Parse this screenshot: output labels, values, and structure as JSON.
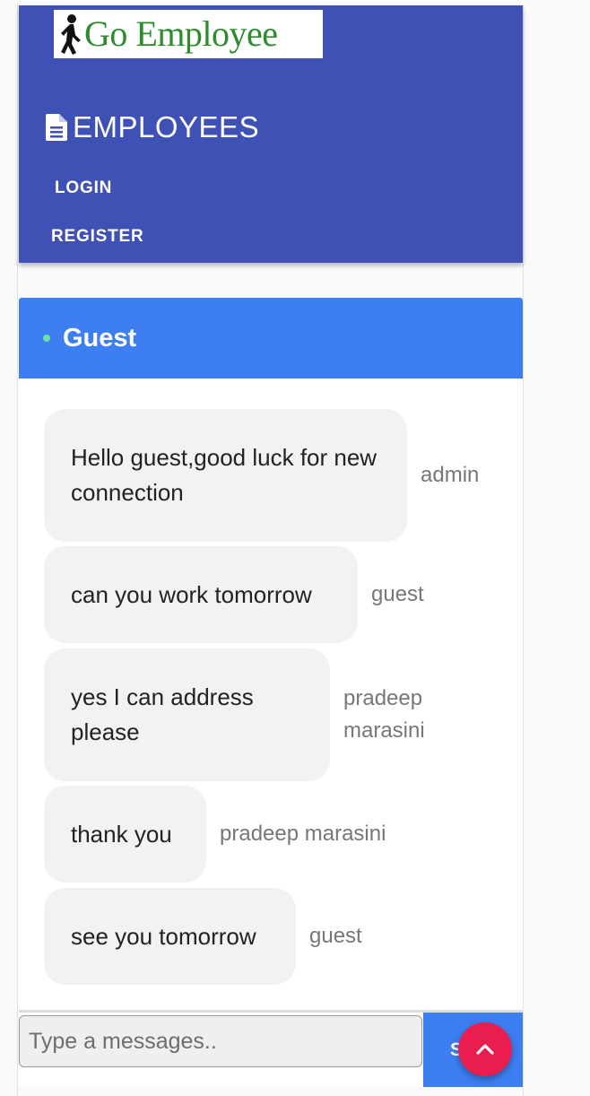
{
  "navbar": {
    "logo_text": "Go Employee",
    "brand_label": "EMPLOYEES",
    "links": [
      {
        "label": "LOGIN"
      },
      {
        "label": "REGISTER"
      }
    ]
  },
  "chat": {
    "title": "Guest",
    "messages": [
      {
        "text": "Hello guest,good luck for new connection",
        "sender": "admin"
      },
      {
        "text": "can you work tomorrow",
        "sender": "guest"
      },
      {
        "text": "yes I can address please",
        "sender": "pradeep marasini"
      },
      {
        "text": "thank you",
        "sender": "pradeep marasini"
      },
      {
        "text": "see you tomorrow",
        "sender": "guest"
      }
    ]
  },
  "composer": {
    "placeholder": "Type a messages..",
    "send_label": "S"
  },
  "icons": {
    "logo": "walking-man-icon",
    "brand": "document-icon",
    "fab": "chevron-up-icon"
  },
  "colors": {
    "navbar": "#3f51b5",
    "chat_header": "#3d7ff1",
    "fab": "#e91e4f",
    "online": "#6ee0a6",
    "logo_text": "#2e8b2e"
  }
}
